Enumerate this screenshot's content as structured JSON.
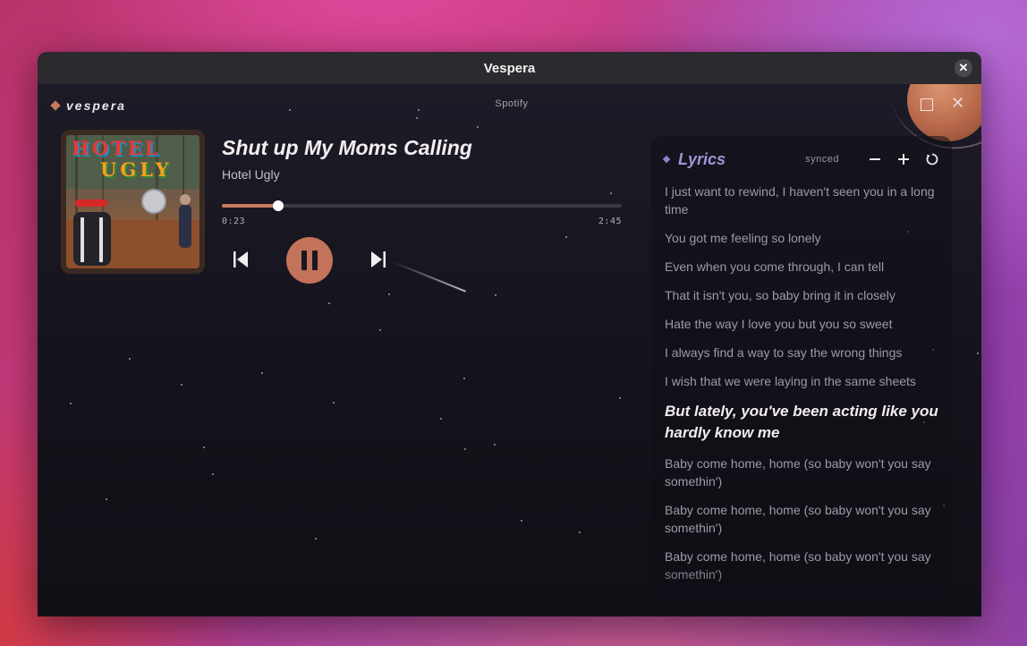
{
  "window": {
    "title": "Vespera"
  },
  "app": {
    "brand": "vespera",
    "source": "Spotify"
  },
  "track": {
    "title": "Shut up My Moms Calling",
    "artist": "Hotel Ugly",
    "current_time": "0:23",
    "total_time": "2:45",
    "progress": 0.14
  },
  "album_art": {
    "text_line1": "HOTEL",
    "text_line2": "UGLY"
  },
  "lyrics": {
    "title": "Lyrics",
    "mode": "synced",
    "lines": [
      "I just want to rewind, I haven't seen you in a long time",
      "You got me feeling so lonely",
      "Even when you come through, I can tell",
      "That it isn't you, so baby bring it in closely",
      "Hate the way I love you but you so sweet",
      "I always find a way to say the wrong things",
      "I wish that we were laying in the same sheets",
      "But lately, you've been acting like you hardly know me",
      "Baby come home, home (so baby won't you say somethin')",
      "Baby come home, home (so baby won't you say somethin')",
      "Baby come home, home (so baby won't you say somethin')"
    ],
    "active_index": 7
  },
  "colors": {
    "accent": "#c2735a",
    "lyrics_title": "#9b97d6"
  },
  "icons": {
    "previous": "skip-previous-icon",
    "pause": "pause-icon",
    "next": "skip-next-icon",
    "decrease": "minus-icon",
    "increase": "plus-icon",
    "reset": "refresh-icon"
  }
}
